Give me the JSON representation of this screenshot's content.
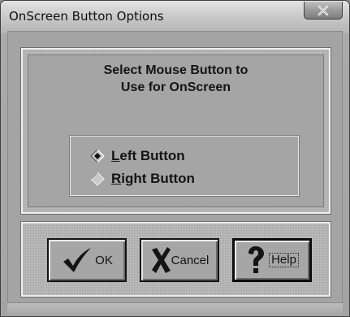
{
  "window": {
    "title": "OnScreen Button Options"
  },
  "icons": {
    "close": "close-icon",
    "ok": "checkmark-icon",
    "cancel": "x-icon",
    "help": "question-mark-icon"
  },
  "prompt": {
    "line1": "Select Mouse Button to",
    "line2": "Use for OnScreen"
  },
  "options": [
    {
      "mnemonic": "L",
      "rest": "eft Button",
      "selected": true
    },
    {
      "mnemonic": "R",
      "rest": "ight Button",
      "selected": false
    }
  ],
  "buttons": {
    "ok": "OK",
    "cancel": "Cancel",
    "help": "Help"
  }
}
